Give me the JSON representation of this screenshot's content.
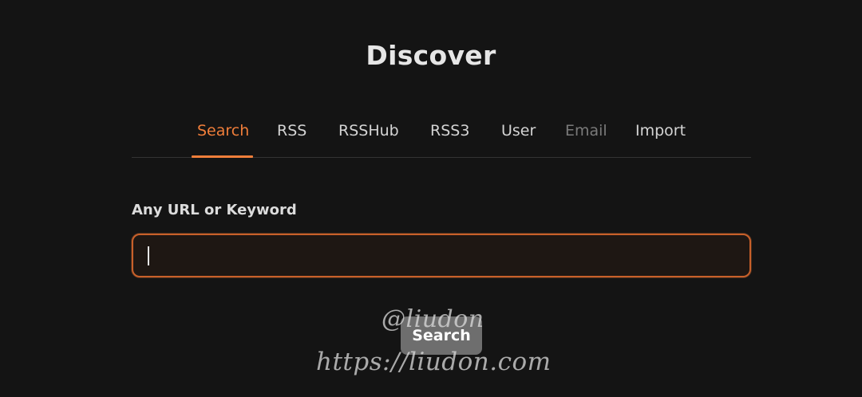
{
  "page": {
    "title": "Discover"
  },
  "tabs": [
    {
      "label": "Search",
      "state": "active"
    },
    {
      "label": "RSS",
      "state": "normal"
    },
    {
      "label": "RSSHub",
      "state": "normal"
    },
    {
      "label": "RSS3",
      "state": "normal"
    },
    {
      "label": "User",
      "state": "normal"
    },
    {
      "label": "Email",
      "state": "disabled"
    },
    {
      "label": "Import",
      "state": "normal"
    }
  ],
  "form": {
    "field_label": "Any URL or Keyword",
    "input_value": "",
    "search_button_label": "Search"
  },
  "watermark": {
    "handle": "@liudon",
    "url": "https://liudon.com"
  },
  "colors": {
    "background": "#141414",
    "accent": "#f07e3a",
    "text": "#d4d4d4",
    "disabled_text": "#7a7a7a"
  }
}
